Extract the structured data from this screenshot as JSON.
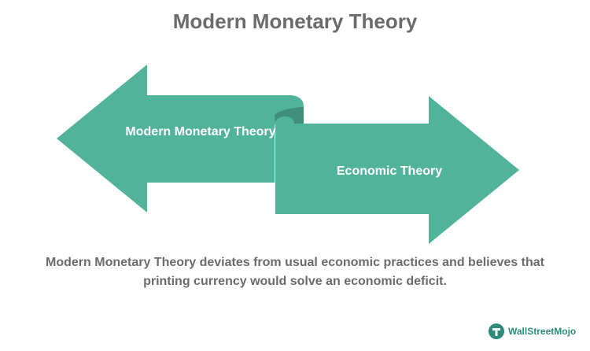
{
  "title": "Modern Monetary Theory",
  "arrows": {
    "left_label": "Modern Monetary Theory",
    "right_label": "Economic Theory"
  },
  "caption": "Modern Monetary Theory deviates from usual economic practices and believes that printing currency would solve an economic deficit.",
  "logo": {
    "text": "WallStreetMojo"
  },
  "colors": {
    "arrow": "#52b39b",
    "arrow_fold": "#3f8f7a",
    "text": "#6b6b6b"
  }
}
